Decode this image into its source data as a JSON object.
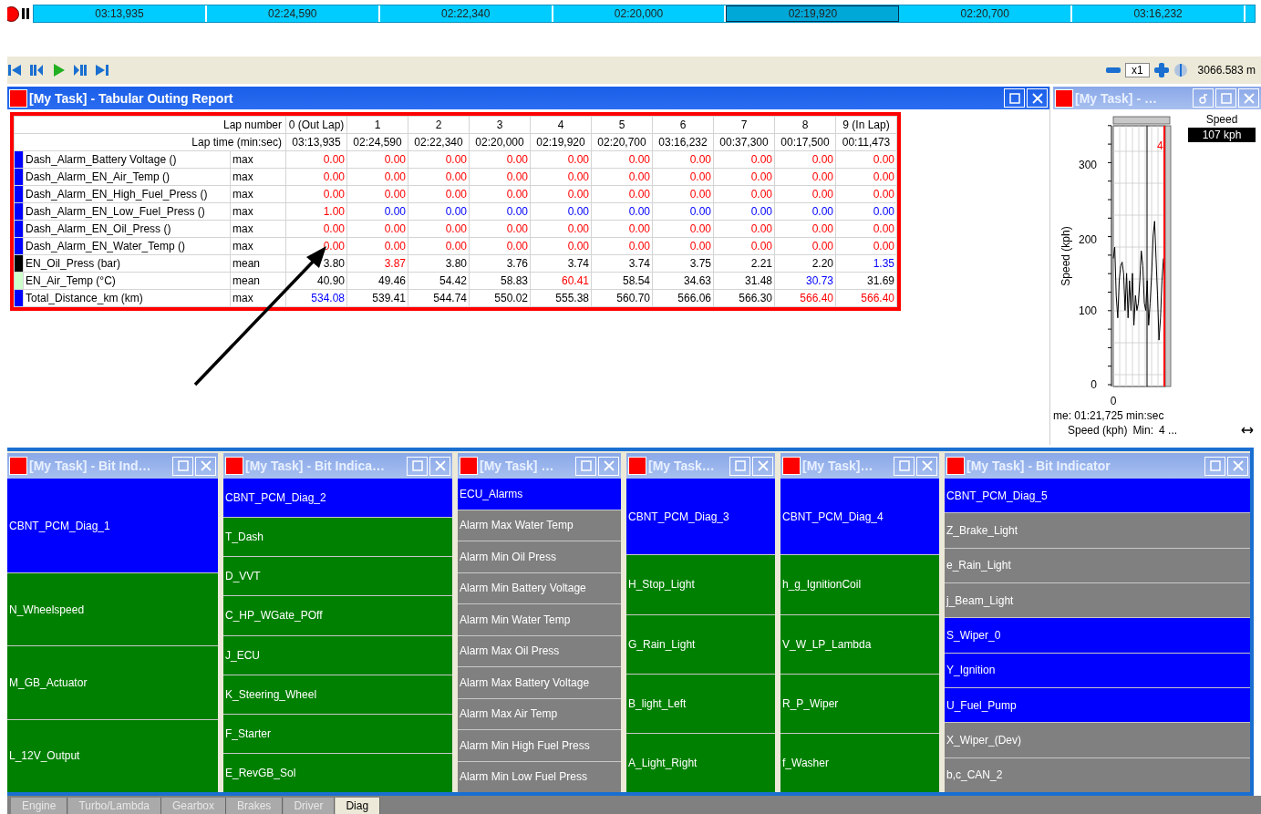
{
  "timeline": {
    "segments": [
      {
        "label": "03:13,935",
        "selected": false
      },
      {
        "label": "02:24,590",
        "selected": false
      },
      {
        "label": "02:22,340",
        "selected": false
      },
      {
        "label": "02:20,000",
        "selected": false
      },
      {
        "label": "02:19,920",
        "selected": true
      },
      {
        "label": "02:20,700",
        "selected": false
      },
      {
        "label": "03:16,232",
        "selected": false
      }
    ]
  },
  "toolbar": {
    "speed": "x1",
    "distance": "3066.583 m"
  },
  "report": {
    "title": "[My Task] - Tabular Outing Report",
    "active": true,
    "lap_label": "Lap number",
    "time_label": "Lap time (min:sec)",
    "laps": [
      "0 (Out Lap)",
      "1",
      "2",
      "3",
      "4",
      "5",
      "6",
      "7",
      "8",
      "9 (In Lap)"
    ],
    "times": [
      "03:13,935",
      "02:24,590",
      "02:22,340",
      "02:20,000",
      "02:19,920",
      "02:20,700",
      "03:16,232",
      "00:37,300",
      "00:17,500",
      "00:11,473"
    ],
    "rows": [
      {
        "name": "Dash_Alarm_Battery Voltage ()",
        "color": "#0000ff",
        "stat": "max",
        "cells": [
          {
            "text": "0.00",
            "kind": "high"
          },
          {
            "text": "0.00",
            "kind": "high"
          },
          {
            "text": "0.00",
            "kind": "high"
          },
          {
            "text": "0.00",
            "kind": "high"
          },
          {
            "text": "0.00",
            "kind": "high"
          },
          {
            "text": "0.00",
            "kind": "high"
          },
          {
            "text": "0.00",
            "kind": "high"
          },
          {
            "text": "0.00",
            "kind": "high"
          },
          {
            "text": "0.00",
            "kind": "high"
          },
          {
            "text": "0.00",
            "kind": "high"
          }
        ]
      },
      {
        "name": "Dash_Alarm_EN_Air_Temp ()",
        "color": "#0000ff",
        "stat": "max",
        "cells": [
          {
            "text": "0.00",
            "kind": "high"
          },
          {
            "text": "0.00",
            "kind": "high"
          },
          {
            "text": "0.00",
            "kind": "high"
          },
          {
            "text": "0.00",
            "kind": "high"
          },
          {
            "text": "0.00",
            "kind": "high"
          },
          {
            "text": "0.00",
            "kind": "high"
          },
          {
            "text": "0.00",
            "kind": "high"
          },
          {
            "text": "0.00",
            "kind": "high"
          },
          {
            "text": "0.00",
            "kind": "high"
          },
          {
            "text": "0.00",
            "kind": "high"
          }
        ]
      },
      {
        "name": "Dash_Alarm_EN_High_Fuel_Press ()",
        "color": "#0000ff",
        "stat": "max",
        "cells": [
          {
            "text": "0.00",
            "kind": "high"
          },
          {
            "text": "0.00",
            "kind": "high"
          },
          {
            "text": "0.00",
            "kind": "high"
          },
          {
            "text": "0.00",
            "kind": "high"
          },
          {
            "text": "0.00",
            "kind": "high"
          },
          {
            "text": "0.00",
            "kind": "high"
          },
          {
            "text": "0.00",
            "kind": "high"
          },
          {
            "text": "0.00",
            "kind": "high"
          },
          {
            "text": "0.00",
            "kind": "high"
          },
          {
            "text": "0.00",
            "kind": "high"
          }
        ]
      },
      {
        "name": "Dash_Alarm_EN_Low_Fuel_Press ()",
        "color": "#0000ff",
        "stat": "max",
        "cells": [
          {
            "text": "1.00",
            "kind": "high"
          },
          {
            "text": "0.00",
            "kind": "low"
          },
          {
            "text": "0.00",
            "kind": "low"
          },
          {
            "text": "0.00",
            "kind": "low"
          },
          {
            "text": "0.00",
            "kind": "low"
          },
          {
            "text": "0.00",
            "kind": "low"
          },
          {
            "text": "0.00",
            "kind": "low"
          },
          {
            "text": "0.00",
            "kind": "low"
          },
          {
            "text": "0.00",
            "kind": "low"
          },
          {
            "text": "0.00",
            "kind": "low"
          }
        ]
      },
      {
        "name": "Dash_Alarm_EN_Oil_Press ()",
        "color": "#0000ff",
        "stat": "max",
        "cells": [
          {
            "text": "0.00",
            "kind": "high"
          },
          {
            "text": "0.00",
            "kind": "high"
          },
          {
            "text": "0.00",
            "kind": "high"
          },
          {
            "text": "0.00",
            "kind": "high"
          },
          {
            "text": "0.00",
            "kind": "high"
          },
          {
            "text": "0.00",
            "kind": "high"
          },
          {
            "text": "0.00",
            "kind": "high"
          },
          {
            "text": "0.00",
            "kind": "high"
          },
          {
            "text": "0.00",
            "kind": "high"
          },
          {
            "text": "0.00",
            "kind": "high"
          }
        ]
      },
      {
        "name": "Dash_Alarm_EN_Water_Temp ()",
        "color": "#0000ff",
        "stat": "max",
        "cells": [
          {
            "text": "0.00",
            "kind": "high"
          },
          {
            "text": "0.00",
            "kind": "high"
          },
          {
            "text": "0.00",
            "kind": "high"
          },
          {
            "text": "0.00",
            "kind": "high"
          },
          {
            "text": "0.00",
            "kind": "high"
          },
          {
            "text": "0.00",
            "kind": "high"
          },
          {
            "text": "0.00",
            "kind": "high"
          },
          {
            "text": "0.00",
            "kind": "high"
          },
          {
            "text": "0.00",
            "kind": "high"
          },
          {
            "text": "0.00",
            "kind": "high"
          }
        ]
      },
      {
        "name": "EN_Oil_Press (bar)",
        "color": "#000000",
        "stat": "mean",
        "cells": [
          {
            "text": "3.80",
            "kind": "normal"
          },
          {
            "text": "3.87",
            "kind": "high"
          },
          {
            "text": "3.80",
            "kind": "normal"
          },
          {
            "text": "3.76",
            "kind": "normal"
          },
          {
            "text": "3.74",
            "kind": "normal"
          },
          {
            "text": "3.74",
            "kind": "normal"
          },
          {
            "text": "3.75",
            "kind": "normal"
          },
          {
            "text": "2.21",
            "kind": "normal"
          },
          {
            "text": "2.20",
            "kind": "normal"
          },
          {
            "text": "1.35",
            "kind": "low"
          }
        ]
      },
      {
        "name": "EN_Air_Temp (°C)",
        "color": "#ccffcc",
        "stat": "mean",
        "cells": [
          {
            "text": "40.90",
            "kind": "normal"
          },
          {
            "text": "49.46",
            "kind": "normal"
          },
          {
            "text": "54.42",
            "kind": "normal"
          },
          {
            "text": "58.83",
            "kind": "normal"
          },
          {
            "text": "60.41",
            "kind": "high"
          },
          {
            "text": "58.54",
            "kind": "normal"
          },
          {
            "text": "34.63",
            "kind": "normal"
          },
          {
            "text": "31.48",
            "kind": "normal"
          },
          {
            "text": "30.73",
            "kind": "low"
          },
          {
            "text": "31.69",
            "kind": "normal"
          }
        ]
      },
      {
        "name": "Total_Distance_km (km)",
        "color": "#0000ff",
        "stat": "max",
        "cells": [
          {
            "text": "534.08",
            "kind": "low"
          },
          {
            "text": "539.41",
            "kind": "normal"
          },
          {
            "text": "544.74",
            "kind": "normal"
          },
          {
            "text": "550.02",
            "kind": "normal"
          },
          {
            "text": "555.38",
            "kind": "normal"
          },
          {
            "text": "560.70",
            "kind": "normal"
          },
          {
            "text": "566.06",
            "kind": "normal"
          },
          {
            "text": "566.30",
            "kind": "normal"
          },
          {
            "text": "566.40",
            "kind": "high"
          },
          {
            "text": "566.40",
            "kind": "high"
          }
        ]
      }
    ]
  },
  "speed_panel": {
    "title": "[My Task] - …",
    "active": false,
    "legend": "Speed",
    "readout": "107 kph",
    "ylabel": "Speed (kph)",
    "yticks": [
      "300",
      "200",
      "100",
      "0"
    ],
    "xtick": "0",
    "lap_marker": "4",
    "time_text": "me: 01:21,725 min:sec",
    "stat_label": "Speed (kph)",
    "min_label": "Min:",
    "min_value": "4 ..."
  },
  "bit_panels": [
    {
      "title": "[My Task] - Bit Ind…",
      "active": false,
      "items": [
        {
          "label": "CBNT_PCM_Diag_1",
          "color": "#0000ff"
        },
        {
          "label": "N_Wheelspeed",
          "color": "#008000"
        },
        {
          "label": "M_GB_Actuator",
          "color": "#008000"
        },
        {
          "label": "L_12V_Output",
          "color": "#008000"
        }
      ]
    },
    {
      "title": "[My Task] - Bit Indica…",
      "active": false,
      "items": [
        {
          "label": "CBNT_PCM_Diag_2",
          "color": "#0000ff"
        },
        {
          "label": "T_Dash",
          "color": "#008000"
        },
        {
          "label": "D_VVT",
          "color": "#008000"
        },
        {
          "label": "C_HP_WGate_POff",
          "color": "#008000"
        },
        {
          "label": "J_ECU",
          "color": "#008000"
        },
        {
          "label": "K_Steering_Wheel",
          "color": "#008000"
        },
        {
          "label": "F_Starter",
          "color": "#008000"
        },
        {
          "label": "E_RevGB_Sol",
          "color": "#008000"
        }
      ]
    },
    {
      "title": "[My Task] …",
      "active": false,
      "items": [
        {
          "label": "ECU_Alarms",
          "color": "#0000ff"
        },
        {
          "label": "Alarm Max Water Temp",
          "color": "#808080"
        },
        {
          "label": "Alarm Min Oil Press",
          "color": "#808080"
        },
        {
          "label": "Alarm Min Battery Voltage",
          "color": "#808080"
        },
        {
          "label": "Alarm Min Water Temp",
          "color": "#808080"
        },
        {
          "label": "Alarm Max Oil Press",
          "color": "#808080"
        },
        {
          "label": "Alarm Max Battery Voltage",
          "color": "#808080"
        },
        {
          "label": "Alarm Max Air Temp",
          "color": "#808080"
        },
        {
          "label": "Alarm Min High Fuel Press",
          "color": "#808080"
        },
        {
          "label": "Alarm Min Low Fuel Press",
          "color": "#808080"
        }
      ]
    },
    {
      "title": "[My Task…",
      "active": false,
      "items": [
        {
          "label": "CBNT_PCM_Diag_3",
          "color": "#0000ff"
        },
        {
          "label": "H_Stop_Light",
          "color": "#008000"
        },
        {
          "label": "G_Rain_Light",
          "color": "#008000"
        },
        {
          "label": "B_light_Left",
          "color": "#008000"
        },
        {
          "label": "A_Light_Right",
          "color": "#008000"
        }
      ]
    },
    {
      "title": "[My Task]…",
      "active": false,
      "items": [
        {
          "label": "CBNT_PCM_Diag_4",
          "color": "#0000ff"
        },
        {
          "label": "h_g_IgnitionCoil",
          "color": "#008000"
        },
        {
          "label": "V_W_LP_Lambda",
          "color": "#008000"
        },
        {
          "label": "R_P_Wiper",
          "color": "#008000"
        },
        {
          "label": "f_Washer",
          "color": "#008000"
        }
      ]
    },
    {
      "title": "[My Task] - Bit Indicator",
      "active": false,
      "items": [
        {
          "label": "CBNT_PCM_Diag_5",
          "color": "#0000ff"
        },
        {
          "label": "Z_Brake_Light",
          "color": "#808080"
        },
        {
          "label": "e_Rain_Light",
          "color": "#808080"
        },
        {
          "label": "j_Beam_Light",
          "color": "#808080"
        },
        {
          "label": "S_Wiper_0",
          "color": "#0000ff"
        },
        {
          "label": "Y_Ignition",
          "color": "#0000ff"
        },
        {
          "label": "U_Fuel_Pump",
          "color": "#0000ff"
        },
        {
          "label": "X_Wiper_(Dev)",
          "color": "#808080"
        },
        {
          "label": "b,c_CAN_2",
          "color": "#808080"
        }
      ]
    }
  ],
  "tabs": [
    {
      "label": "Engine",
      "selected": false
    },
    {
      "label": "Turbo/Lambda",
      "selected": false
    },
    {
      "label": "Gearbox",
      "selected": false
    },
    {
      "label": "Brakes",
      "selected": false
    },
    {
      "label": "Driver",
      "selected": false
    },
    {
      "label": "Diag",
      "selected": true
    }
  ]
}
